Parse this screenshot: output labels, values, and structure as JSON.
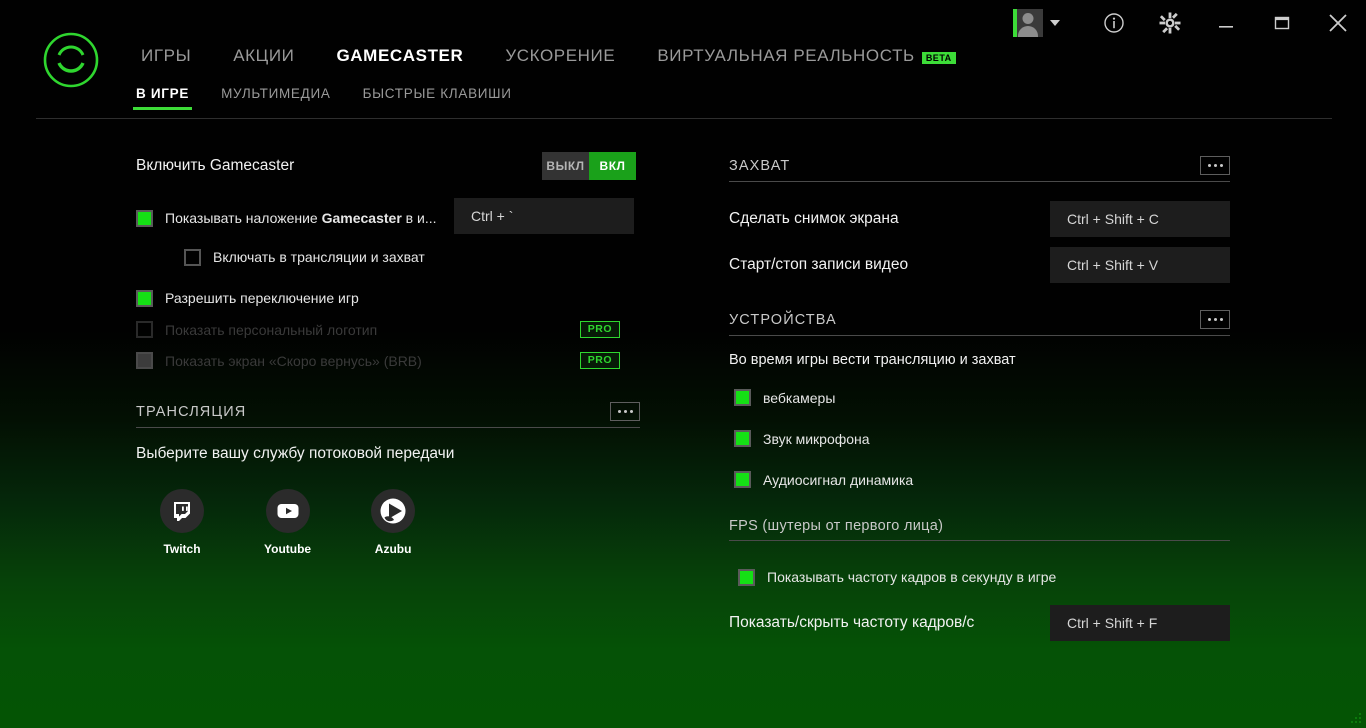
{
  "titlebar": {
    "account": {
      "name": "account-avatar",
      "dropdown_label": ""
    },
    "buttons": [
      {
        "id": "info",
        "label": "i"
      },
      {
        "id": "settings",
        "label": ""
      },
      {
        "id": "minimize",
        "label": ""
      },
      {
        "id": "maximize",
        "label": ""
      },
      {
        "id": "close",
        "label": ""
      }
    ]
  },
  "nav": {
    "items": [
      {
        "label": "ИГРЫ",
        "active": false
      },
      {
        "label": "АКЦИИ",
        "active": false
      },
      {
        "label": "GAMECASTER",
        "active": true
      },
      {
        "label": "УСКОРЕНИЕ",
        "active": false
      },
      {
        "label": "ВИРТУАЛЬНАЯ РЕАЛЬНОСТЬ",
        "active": false,
        "badge": "BETA"
      }
    ],
    "sub_items": [
      {
        "label": "В ИГРЕ",
        "active": true
      },
      {
        "label": "МУЛЬТИМЕДИА",
        "active": false
      },
      {
        "label": "БЫСТРЫЕ КЛАВИШИ",
        "active": false
      }
    ]
  },
  "left": {
    "enable": {
      "label": "Включить Gamecaster",
      "toggle_off": "ВЫКЛ",
      "toggle_on": "ВКЛ",
      "state": "on"
    },
    "overlay": {
      "label_prefix": "Показывать наложение ",
      "label_bold": "Gamecaster",
      "label_suffix": " в и...",
      "checked": true,
      "hotkey": "Ctrl + `"
    },
    "include_broadcast": {
      "label": "Включать в трансляции и захват",
      "checked": false
    },
    "allow_switch": {
      "label": "Разрешить переключение игр",
      "checked": true
    },
    "personal_logo": {
      "label": "Показать персональный логотип",
      "checked": false,
      "badge": "PRO",
      "disabled": true
    },
    "brb_screen": {
      "label": "Показать экран «Скоро вернусь» (BRB)",
      "checked": "partial",
      "badge": "PRO",
      "disabled": true
    },
    "broadcast_section": {
      "title": "ТРАНСЛЯЦИЯ",
      "menu": "•••",
      "subtitle": "Выберите вашу службу потоковой передачи",
      "services": [
        {
          "name": "Twitch",
          "icon": "twitch-icon"
        },
        {
          "name": "Youtube",
          "icon": "youtube-icon"
        },
        {
          "name": "Azubu",
          "icon": "azubu-icon"
        }
      ]
    }
  },
  "right": {
    "capture_section": {
      "title": "ЗАХВАТ",
      "menu": "•••",
      "rows": [
        {
          "label": "Сделать снимок экрана",
          "hotkey": "Ctrl + Shift + C"
        },
        {
          "label": "Старт/стоп записи видео",
          "hotkey": "Ctrl + Shift + V"
        }
      ]
    },
    "devices_section": {
      "title": "УСТРОЙСТВА",
      "menu": "•••",
      "subtitle": "Во время игры вести трансляцию и захват",
      "items": [
        {
          "label": "вебкамеры",
          "checked": true
        },
        {
          "label": "Звук микрофона",
          "checked": true
        },
        {
          "label": "Аудиосигнал динамика",
          "checked": true
        }
      ]
    },
    "fps_section": {
      "title": "FPS (шутеры от первого лица)",
      "show_fps": {
        "label": "Показывать частоту кадров в секунду в игре",
        "checked": true
      },
      "hotkey_row": {
        "label": "Показать/скрыть частоту кадров/с",
        "hotkey": "Ctrl + Shift + F"
      }
    }
  },
  "colors": {
    "accent_green": "#3ddc38",
    "checkbox_green": "#15e015",
    "toggle_on": "#1aa11a",
    "bg_black": "#010101",
    "bg_green": "#045404"
  }
}
